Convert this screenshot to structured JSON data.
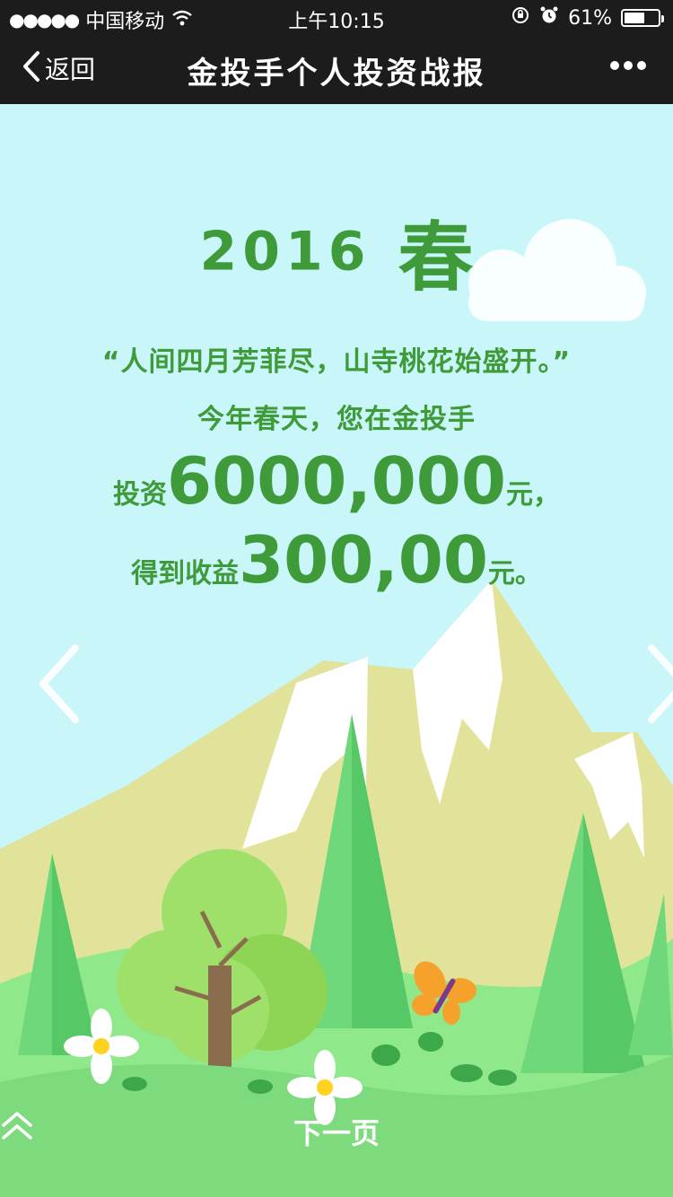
{
  "status_bar": {
    "signal": "●●●●●",
    "carrier": "中国移动",
    "time": "上午10:15",
    "battery_percent": "61%",
    "battery_level": 0.61
  },
  "nav": {
    "back_label": "返回",
    "title": "金投手个人投资战报",
    "more_icon": "more-dots-icon"
  },
  "report": {
    "year": "2016",
    "season": "春",
    "poem": "“人间四月芳菲尽，山寺桃花始盛开。”",
    "intro": "今年春天，您在金投手",
    "invest_prefix": "投资",
    "invest_amount": "6000,000",
    "invest_suffix": "元，",
    "profit_prefix": "得到收益",
    "profit_amount": "300,00",
    "profit_suffix": "元。"
  },
  "controls": {
    "prev_icon": "chevron-left-icon",
    "next_icon": "chevron-right-icon",
    "next_page_label": "下一页"
  },
  "colors": {
    "sky": "#c9f6f8",
    "accent_green": "#3f9b3a",
    "bar": "#1c1c1c",
    "mountain": "#e2e39a",
    "snow": "#ffffff"
  }
}
